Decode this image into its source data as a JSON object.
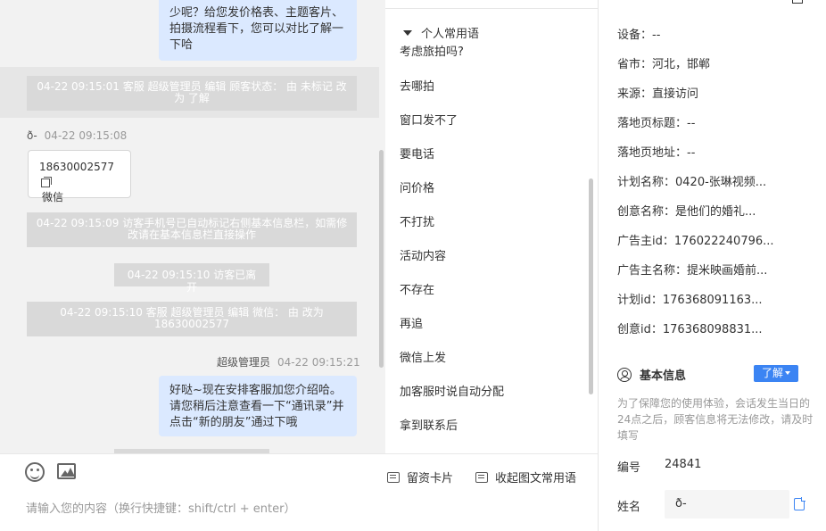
{
  "chat": {
    "bubble1": [
      "少呢？给您发价格表、主题客片、",
      "拍摄流程看下，您可以对比了解一",
      "下哈"
    ],
    "sys1": "04-22 09:15:01 客服 超级管理员 编辑 顾客状态： 由 未标记 改为 了解",
    "visitor_name": "ð-",
    "visitor_time": "04-22 09:15:08",
    "card_phone": "18630002577",
    "card_type": "微信",
    "sys2": "04-22 09:15:09 访客手机号已自动标记右侧基本信息栏，如需修改请在基本信息栏直接操作",
    "sys3": "04-22 09:15:10 访客已离开",
    "sys4": "04-22 09:15:10 客服 超级管理员 编辑 微信： 由 改为 18630002577",
    "agent_name": "超级管理员",
    "agent_time": "04-22 09:15:21",
    "bubble2": [
      "好哒~现在安排客服加您介绍哈。",
      "请您稍后注意查看一下“通讯录”并",
      "点击“新的朋友”通过下哦"
    ]
  },
  "input": {
    "emoji_icon": "emoji-icon",
    "image_icon": "image-icon",
    "card_label": "留资卡片",
    "collapse_label": "收起图文常用语",
    "placeholder": "请输入您的内容（换行快捷键：shift/ctrl + enter）"
  },
  "phrases": {
    "header": "个人常用语",
    "items": [
      "考虑旅拍吗?",
      "去哪拍",
      "窗口发不了",
      "要电话",
      "问价格",
      "不打扰",
      "活动内容",
      "不存在",
      "再追",
      "微信上发",
      "加客服时说自动分配",
      "拿到联系后"
    ]
  },
  "info": {
    "source_rows": [
      {
        "label": "设备：",
        "value": "--"
      },
      {
        "label": "省市：",
        "value": "河北，邯郸"
      },
      {
        "label": "来源：",
        "value": "直接访问"
      },
      {
        "label": "落地页标题：",
        "value": "--"
      },
      {
        "label": "落地页地址：",
        "value": "--"
      },
      {
        "label": "计划名称：",
        "value": "0420-张琳视频..."
      },
      {
        "label": "创意名称：",
        "value": "是他们的婚礼..."
      },
      {
        "label": "广告主id：",
        "value": "176022240796..."
      },
      {
        "label": "广告主名称：",
        "value": "提米映画婚前..."
      },
      {
        "label": "计划id：",
        "value": "176368091163..."
      },
      {
        "label": "创意id：",
        "value": "176368098831..."
      }
    ],
    "basic_title": "基本信息",
    "learn_label": "了解",
    "hint": "为了保障您的使用体验，会话发生当日的24点之后，顾客信息将无法修改，请及时填写",
    "number_label": "编号",
    "number_value": "24841",
    "name_label": "姓名",
    "name_value": "ð-"
  },
  "colors": {
    "accent": "#3b84f3",
    "bubble": "#dbe9ff",
    "system": "#d9d9d9"
  }
}
